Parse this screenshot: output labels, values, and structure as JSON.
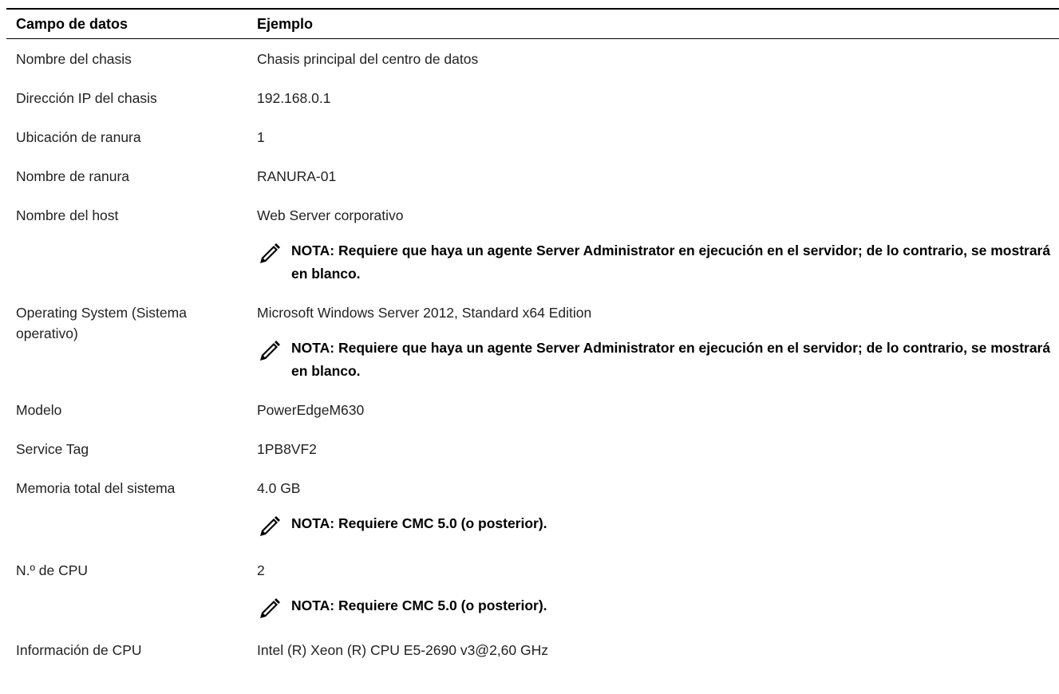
{
  "table": {
    "headers": [
      "Campo de datos",
      "Ejemplo"
    ],
    "rows": [
      {
        "field": "Nombre del chasis",
        "value": "Chasis principal del centro de datos"
      },
      {
        "field": "Dirección IP del chasis",
        "value": "192.168.0.1"
      },
      {
        "field": "Ubicación de ranura",
        "value": "1"
      },
      {
        "field": "Nombre de ranura",
        "value": "RANURA-01"
      },
      {
        "field": "Nombre del host",
        "value": "Web Server corporativo",
        "note": "NOTA: Requiere que haya un agente Server Administrator en ejecución en el servidor; de lo contrario, se mostrará en blanco."
      },
      {
        "field": "Operating System (Sistema operativo)",
        "value": "Microsoft Windows Server 2012, Standard x64 Edition",
        "note": "NOTA: Requiere que haya un agente Server Administrator en ejecución en el servidor; de lo contrario, se mostrará en blanco."
      },
      {
        "field": "Modelo",
        "value": "PowerEdgeM630"
      },
      {
        "field": "Service Tag",
        "value": "1PB8VF2"
      },
      {
        "field": "Memoria total del sistema",
        "value": "4.0 GB",
        "note": "NOTA: Requiere CMC 5.0 (o posterior)."
      },
      {
        "field": "N.º de CPU",
        "value": "2",
        "note": "NOTA: Requiere CMC 5.0 (o posterior)."
      },
      {
        "field": "Información de CPU",
        "value": "Intel (R) Xeon (R) CPU E5-2690 v3@2,60 GHz"
      }
    ]
  },
  "icons": {
    "note": "pencil-note-icon"
  }
}
